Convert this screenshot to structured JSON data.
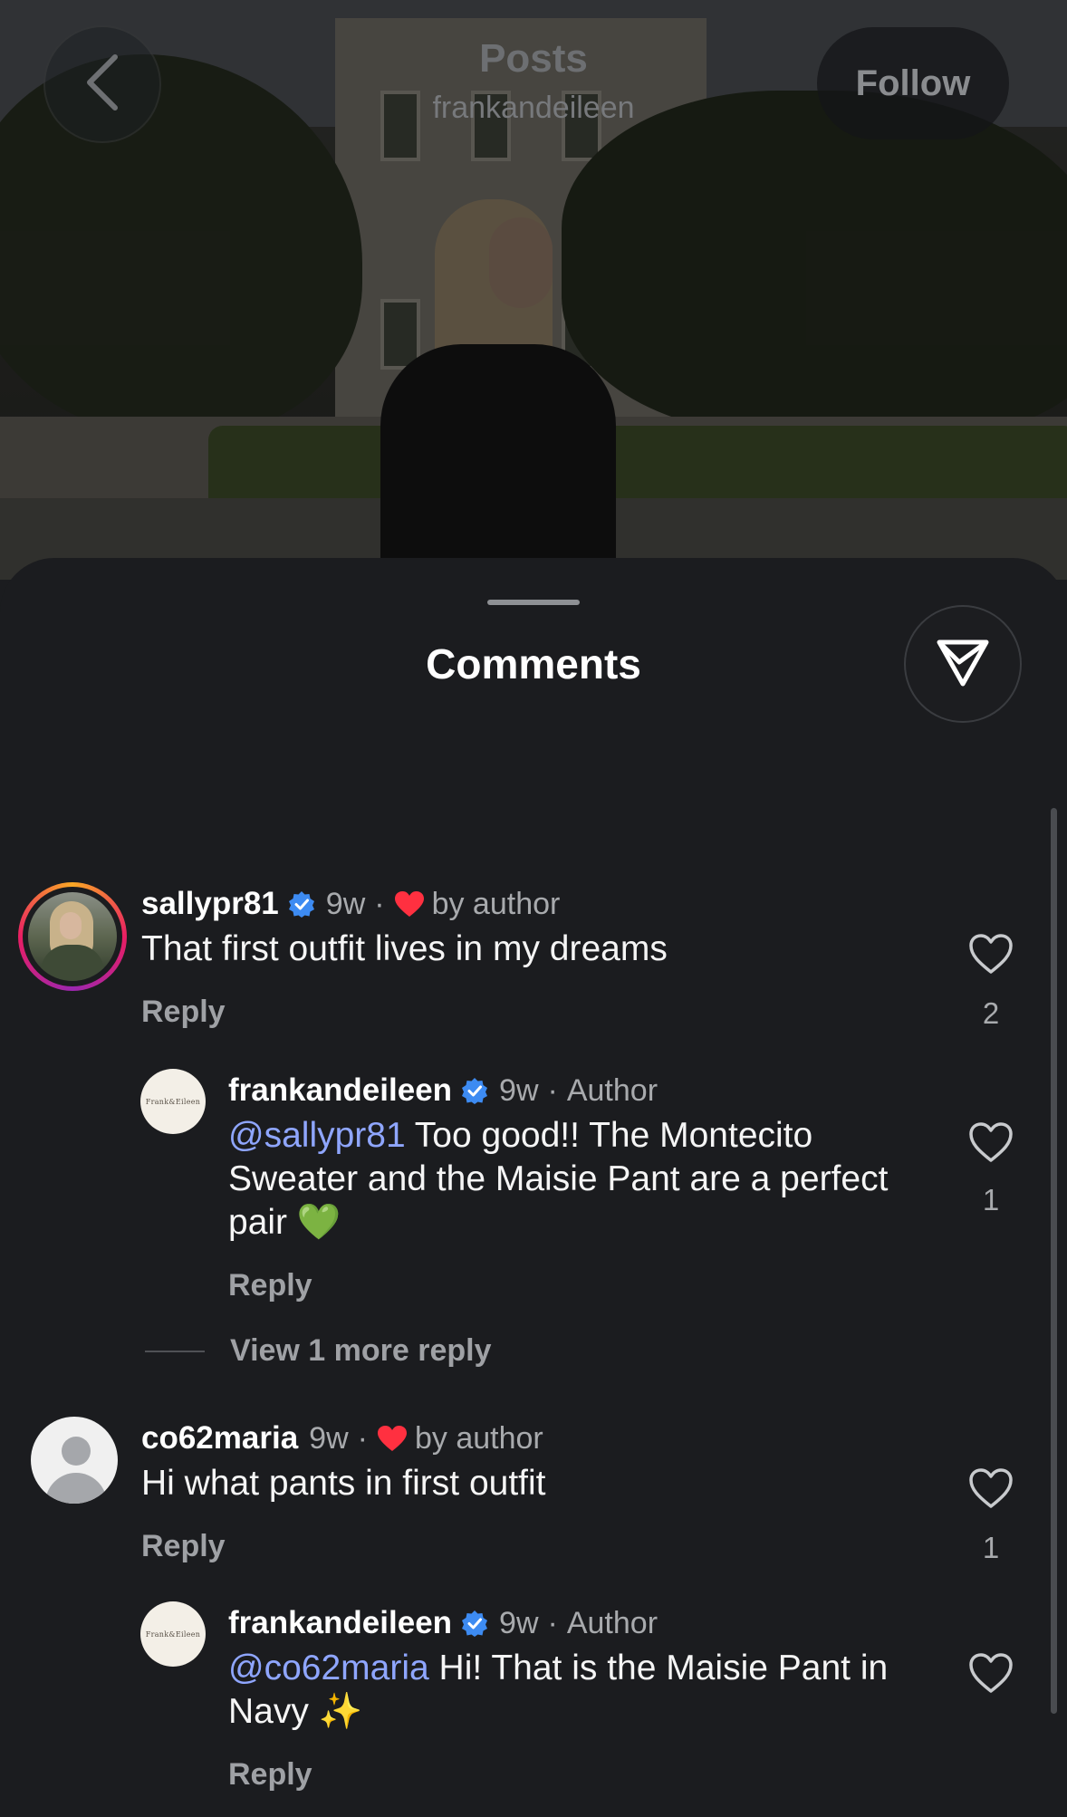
{
  "header": {
    "title": "Posts",
    "subtitle": "frankandeileen",
    "follow_label": "Follow"
  },
  "sheet": {
    "title": "Comments"
  },
  "comments": [
    {
      "user": "sallypr81",
      "time": "9w",
      "liked_by_author_label": "by author",
      "text": "That first outfit lives in my dreams",
      "reply_label": "Reply",
      "like_count": "2"
    },
    {
      "user": "frankandeileen",
      "time": "9w",
      "author_badge": "Author",
      "mention": "@sallypr81",
      "text": " Too good!! The Montecito Sweater and the Maisie Pant are a perfect pair 💚",
      "reply_label": "Reply",
      "like_count": "1",
      "avatar_text": "Frank&Eileen"
    },
    {
      "view_more_label": "View 1 more reply"
    },
    {
      "user": "co62maria",
      "time": "9w",
      "liked_by_author_label": "by author",
      "text": "Hi what pants in first outfit",
      "reply_label": "Reply",
      "like_count": "1"
    },
    {
      "user": "frankandeileen",
      "time": "9w",
      "author_badge": "Author",
      "mention": "@co62maria",
      "text": " Hi! That is the Maisie Pant in Navy ✨",
      "reply_label": "Reply",
      "avatar_text": "Frank&Eileen"
    }
  ],
  "icons": {
    "back": "chevron-left-icon",
    "share": "paper-plane-icon",
    "verified": "verified-badge-icon",
    "like": "heart-outline-icon",
    "liked_by_author": "heart-filled-icon"
  },
  "colors": {
    "sheet_bg": "#1b1c1f",
    "mention": "#8fa6ff",
    "verified": "#3d8bf2",
    "heart_red": "#ff3040"
  }
}
